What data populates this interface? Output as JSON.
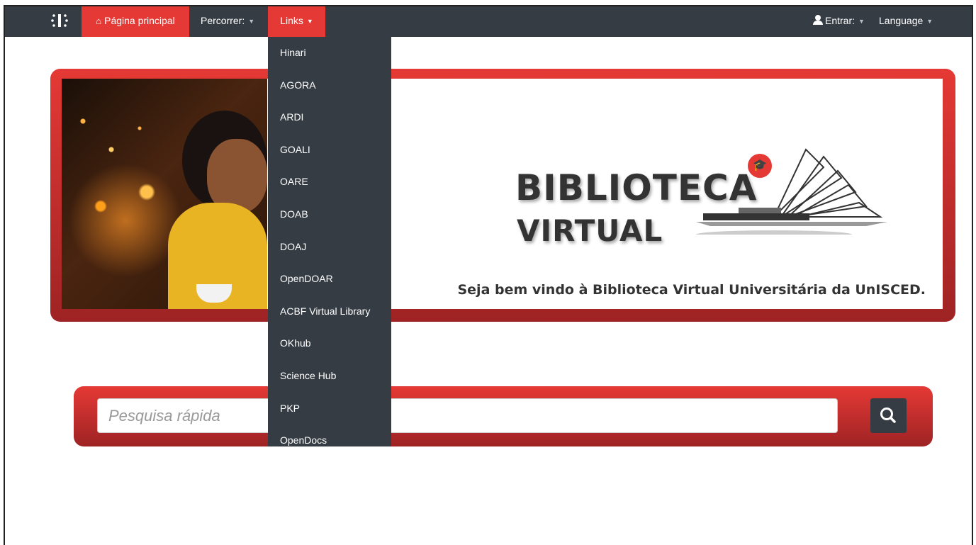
{
  "navbar": {
    "brand_icon": "dspace-logo-icon",
    "home_label": "Página principal",
    "browse_label": "Percorrer:",
    "links_label": "Links",
    "login_label": "Entrar:",
    "language_label": "Language",
    "active_color": "#e53935",
    "background_color": "#353c44"
  },
  "links_menu": {
    "items": [
      "Hinari",
      "AGORA",
      "ARDI",
      "GOALI",
      "OARE",
      "DOAB",
      "DOAJ",
      "OpenDOAR",
      "ACBF Virtual Library",
      "OKhub",
      "Science Hub",
      "PKP",
      "OpenDocs"
    ]
  },
  "banner": {
    "logo_line1": "BIBLIOTECA",
    "logo_line2": "VIRTUAL",
    "welcome_text": "Seja bem vindo à Biblioteca Virtual Universitária da UnISCED."
  },
  "search": {
    "placeholder": "Pesquisa rápida",
    "value": "",
    "button_icon": "search-icon"
  }
}
